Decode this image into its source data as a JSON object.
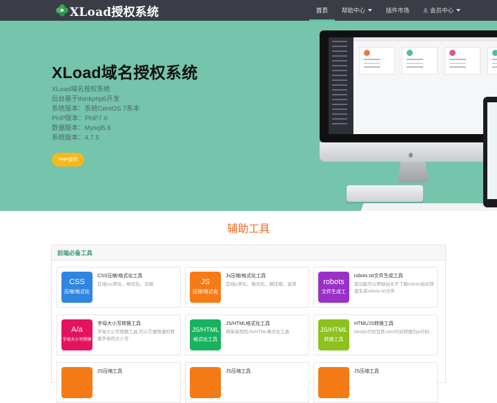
{
  "brand": {
    "title": "XLoad授权系统"
  },
  "nav": {
    "items": [
      {
        "label": "首页",
        "active": true,
        "dropdown": false
      },
      {
        "label": "帮助中心",
        "active": false,
        "dropdown": true
      },
      {
        "label": "插件市场",
        "active": false,
        "dropdown": false
      },
      {
        "label": "会员中心",
        "active": false,
        "dropdown": true,
        "icon": "user-icon"
      }
    ]
  },
  "hero": {
    "title": "XLoad域名授权系统",
    "lines": [
      "XLoad域名授权系统",
      "后台基于thinkphp6开发",
      "系统版本：系统CentOS 7系本",
      "PHP版本：PHP7.0",
      "数据版本：Mysql5.6",
      "系统版本：4.7.5"
    ],
    "button": "PHP组件"
  },
  "tools": {
    "section_title": "辅助工具",
    "panel_title": "前端必备工具",
    "cards": [
      {
        "tile_main": "CSS",
        "tile_sub": "压缩/格式化",
        "tile_color": "#2f86e0",
        "title": "CSS压缩/格式化工具",
        "desc": "在线css美化、格式化、压缩"
      },
      {
        "tile_main": "JS",
        "tile_sub": "压缩/格式化",
        "tile_color": "#f47b16",
        "title": "Js压缩/格式化工具",
        "desc": "在线js美化、格式化、解压缩、混淆"
      },
      {
        "tile_main": "robots",
        "tile_sub": "文件生成工",
        "tile_color": "#9a31c7",
        "title": "robots.txt文件生成工具",
        "desc": "该功能可以帮助站长不了解robots协议快速生成robots.txt文件"
      },
      {
        "tile_main": "A/a",
        "tile_sub": "字母大小写转换",
        "tile_color": "#e4135e",
        "title": "字母大小写转换工具",
        "desc": "字母大小写转换工具,可以方便快速的转换字母的大小写"
      },
      {
        "tile_main": "JS/HTML",
        "tile_sub": "格式化工具",
        "tile_color": "#18b35e",
        "title": "JS/HTML格式化工具",
        "desc": "简单易用的JS/HTML格式化工具"
      },
      {
        "tile_main": "JS/HTML",
        "tile_sub": "转换工具",
        "tile_color": "#8cc11e",
        "title": "HTML/JS转换工具",
        "desc": "html/js代码互转,html代码转换为js代码"
      },
      {
        "tile_main": "",
        "tile_sub": "",
        "tile_color": "#f47b16",
        "title": "JS压缩工具",
        "desc": ""
      },
      {
        "tile_main": "",
        "tile_sub": "",
        "tile_color": "#f47b16",
        "title": "JS压缩工具",
        "desc": ""
      },
      {
        "tile_main": "",
        "tile_sub": "",
        "tile_color": "#f47b16",
        "title": "JS压缩工具",
        "desc": ""
      }
    ]
  }
}
